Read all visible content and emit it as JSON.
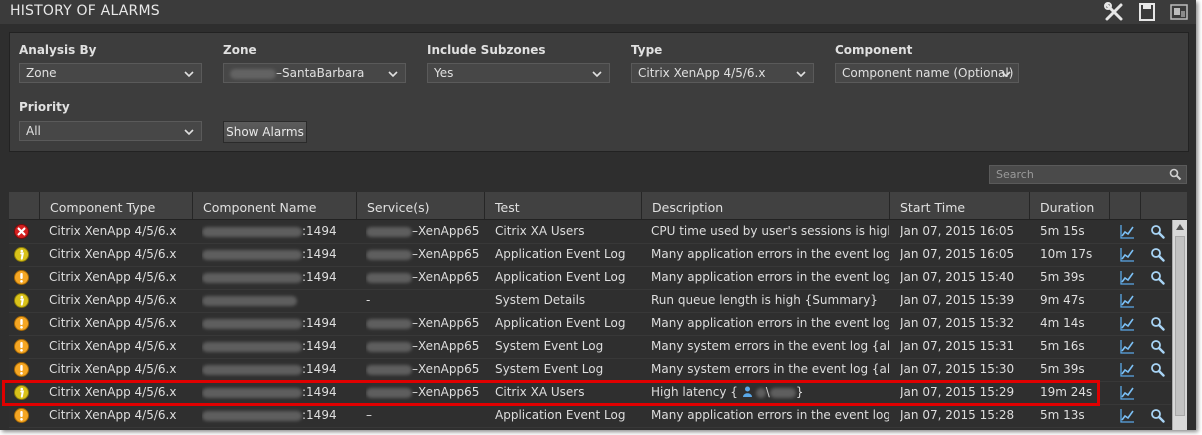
{
  "window": {
    "title": "HISTORY OF ALARMS"
  },
  "filters": {
    "analysis_by": {
      "label": "Analysis By",
      "value": "Zone"
    },
    "zone": {
      "label": "Zone",
      "value_suffix": "–SantaBarbara"
    },
    "include_subzones": {
      "label": "Include Subzones",
      "value": "Yes"
    },
    "type": {
      "label": "Type",
      "value": "Citrix XenApp 4/5/6.x"
    },
    "component": {
      "label": "Component",
      "value": "Component name (Optional)"
    },
    "priority": {
      "label": "Priority",
      "value": "All"
    },
    "show_alarms_label": "Show Alarms"
  },
  "search": {
    "placeholder": "Search"
  },
  "table": {
    "columns": [
      "Component Type",
      "Component Name",
      "Service(s)",
      "Test",
      "Description",
      "Start Time",
      "Duration"
    ],
    "rows": [
      {
        "severity": "critical",
        "type": "Citrix XenApp 4/5/6.x",
        "name_suffix": ":1494",
        "service": "–XenApp65",
        "test": "Citrix XA Users",
        "description": "CPU time used by user's sessions is high…",
        "start": "Jan 07, 2015 16:05",
        "duration": "5m 15s",
        "graph": true,
        "detail": true
      },
      {
        "severity": "minor",
        "type": "Citrix XenApp 4/5/6.x",
        "name_suffix": ":1494",
        "service": "–XenApp65",
        "test": "Application Event Log",
        "description": "Many application errors in the event log …",
        "start": "Jan 07, 2015 16:05",
        "duration": "10m 17s",
        "graph": true,
        "detail": true
      },
      {
        "severity": "major",
        "type": "Citrix XenApp 4/5/6.x",
        "name_suffix": ":1494",
        "service": "–XenApp65",
        "test": "Application Event Log",
        "description": "Many application errors in the event log …",
        "start": "Jan 07, 2015 15:40",
        "duration": "5m 39s",
        "graph": true,
        "detail": true
      },
      {
        "severity": "minor",
        "type": "Citrix XenApp 4/5/6.x",
        "name_suffix": "",
        "service": "-",
        "test": "System Details",
        "description": "Run queue length is high {Summary}",
        "start": "Jan 07, 2015 15:39",
        "duration": "9m 47s",
        "graph": true,
        "detail": false
      },
      {
        "severity": "major",
        "type": "Citrix XenApp 4/5/6.x",
        "name_suffix": ":1494",
        "service": "–XenApp65",
        "test": "Application Event Log",
        "description": "Many application errors in the event log …",
        "start": "Jan 07, 2015 15:32",
        "duration": "4m 14s",
        "graph": true,
        "detail": true
      },
      {
        "severity": "major",
        "type": "Citrix XenApp 4/5/6.x",
        "name_suffix": ":1494",
        "service": "–XenApp65",
        "test": "System Event Log",
        "description": "Many system errors in the event log {all}",
        "start": "Jan 07, 2015 15:31",
        "duration": "5m 16s",
        "graph": true,
        "detail": true
      },
      {
        "severity": "major",
        "type": "Citrix XenApp 4/5/6.x",
        "name_suffix": ":1494",
        "service": "–XenApp65",
        "test": "System Event Log",
        "description": "Many system errors in the event log {all}",
        "start": "Jan 07, 2015 15:30",
        "duration": "5m 39s",
        "graph": true,
        "detail": true
      },
      {
        "severity": "minor",
        "type": "Citrix XenApp 4/5/6.x",
        "name_suffix": ":1494",
        "service": "–XenApp65",
        "test": "Citrix XA Users",
        "description": "High latency {",
        "description_tail": "}",
        "start": "Jan 07, 2015 15:29",
        "duration": "19m 24s",
        "graph": true,
        "detail": false,
        "highlighted": true
      },
      {
        "severity": "major",
        "type": "Citrix XenApp 4/5/6.x",
        "name_suffix": ":1494",
        "service": "–",
        "test": "Application Event Log",
        "description": "Many application errors in the event log …",
        "start": "Jan 07, 2015 15:28",
        "duration": "5m 13s",
        "graph": true,
        "detail": true
      }
    ]
  },
  "colors": {
    "critical": "#d42020",
    "major": "#f5a623",
    "minor": "#d9c21a",
    "highlight": "#e00000"
  }
}
